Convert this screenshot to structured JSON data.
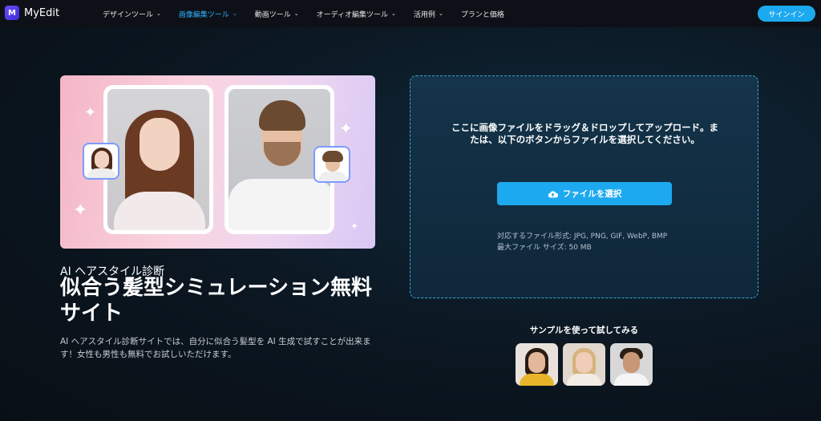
{
  "nav": {
    "logo_text": "MyEdit",
    "logo_mark": "M",
    "items": [
      {
        "label": "デザインツール",
        "active": false
      },
      {
        "label": "画像編集ツール",
        "active": true
      },
      {
        "label": "動画ツール",
        "active": false
      },
      {
        "label": "オーディオ編集ツール",
        "active": false
      },
      {
        "label": "活用例",
        "active": false
      },
      {
        "label": "プランと価格",
        "active": false
      }
    ],
    "chevron": "⌄",
    "signin_label": "サインイン"
  },
  "hero": {
    "subtitle": "AI ヘアスタイル診断",
    "title": "似合う髪型シミュレーション無料サイト",
    "description": "AI ヘアスタイル診断サイトでは、自分に似合う髪型を AI 生成で試すことが出来ます！女性も男性も無料でお試しいただけます。"
  },
  "upload": {
    "message": "ここに画像ファイルをドラッグ＆ドロップしてアップロード。または、以下のボタンからファイルを選択してください。",
    "button_label": "ファイルを選択",
    "button_icon": "cloud-upload-icon",
    "formats": "対応するファイル形式: JPG, PNG, GIF, WebP, BMP",
    "max_size": "最大ファイル サイズ: 50 MB"
  },
  "samples": {
    "label": "サンプルを使って試してみる",
    "items": [
      "sample-woman-yellow",
      "sample-woman-blonde",
      "sample-man-beard"
    ]
  },
  "colors": {
    "accent": "#1da9ef",
    "active_nav": "#2fb2ff",
    "background": "#0b1620",
    "dash_border": "#3aa6d9"
  }
}
